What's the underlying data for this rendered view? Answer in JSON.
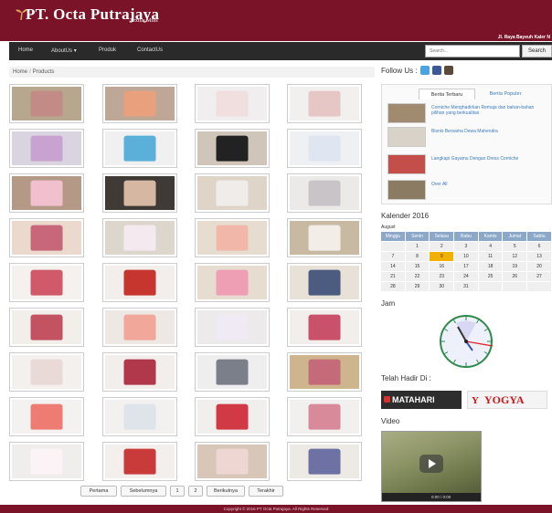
{
  "header": {
    "brand": "PT. Octa Putrajaya",
    "tagline": "Textile Mills",
    "address": "Jl. Raya Bayeuh Kaler N"
  },
  "nav": {
    "items": [
      "Home",
      "AboutUs",
      "Produk",
      "ContactUs"
    ],
    "search_placeholder": "Search...",
    "search_button": "Search"
  },
  "breadcrumb": [
    "Home",
    "Products"
  ],
  "products": [
    {
      "bg": "#b8a78f",
      "color": "#c28b86"
    },
    {
      "bg": "#bea796",
      "color": "#e8a07d"
    },
    {
      "bg": "#f0eeee",
      "color": "#f1dede"
    },
    {
      "bg": "#f2f0ee",
      "color": "#e7c7c6"
    },
    {
      "bg": "#d9d4e0",
      "color": "#c8a2d0"
    },
    {
      "bg": "#f0f0f0",
      "color": "#5ab0d8"
    },
    {
      "bg": "#cfc6b9",
      "color": "#222222"
    },
    {
      "bg": "#eef0f4",
      "color": "#dfe6f2"
    },
    {
      "bg": "#b49a86",
      "color": "#f1c0cf"
    },
    {
      "bg": "#3f3a36",
      "color": "#d6b7a2"
    },
    {
      "bg": "#ded5c8",
      "color": "#f0ecea"
    },
    {
      "bg": "#eceae8",
      "color": "#c8c4c8"
    },
    {
      "bg": "#ead9cc",
      "color": "#c8677a"
    },
    {
      "bg": "#ddd6cc",
      "color": "#f3e9ee"
    },
    {
      "bg": "#e6ddd0",
      "color": "#f1b8aa"
    },
    {
      "bg": "#c8b9a2",
      "color": "#f2ede7"
    },
    {
      "bg": "#f4f1ee",
      "color": "#d15a6a"
    },
    {
      "bg": "#f2eeec",
      "color": "#c7352f"
    },
    {
      "bg": "#e6dccf",
      "color": "#ee9fb4"
    },
    {
      "bg": "#e7e1d8",
      "color": "#4c5c80"
    },
    {
      "bg": "#f2eeea",
      "color": "#c45362"
    },
    {
      "bg": "#ede8e4",
      "color": "#f1a79a"
    },
    {
      "bg": "#eceaea",
      "color": "#efeaf4"
    },
    {
      "bg": "#f1eeec",
      "color": "#c9526a"
    },
    {
      "bg": "#f3f0ee",
      "color": "#e9dad8"
    },
    {
      "bg": "#f1eeec",
      "color": "#b0384a"
    },
    {
      "bg": "#efeeee",
      "color": "#7b7f8a"
    },
    {
      "bg": "#cfb58e",
      "color": "#c56a78"
    },
    {
      "bg": "#f4f2f0",
      "color": "#ef7c72"
    },
    {
      "bg": "#f3f1ef",
      "color": "#dfe3ea"
    },
    {
      "bg": "#f1efee",
      "color": "#d13a44"
    },
    {
      "bg": "#f2f0ef",
      "color": "#d88a9a"
    },
    {
      "bg": "#f0eeec",
      "color": "#fbf3f5"
    },
    {
      "bg": "#f2efec",
      "color": "#c93b3b"
    },
    {
      "bg": "#d8c6b8",
      "color": "#eed6d2"
    },
    {
      "bg": "#ede9e4",
      "color": "#6e71a3"
    }
  ],
  "pager": [
    "Pertama",
    "Sebelumnya",
    "1",
    "2",
    "Berikutnya",
    "Terakhir"
  ],
  "follow": {
    "label": "Follow Us :",
    "icons": [
      "twitter-icon",
      "facebook-icon",
      "instagram-icon"
    ],
    "colors": [
      "#4aa3df",
      "#3b5998",
      "#5b4a3a"
    ]
  },
  "tabs": {
    "active": "Berita Terbaru",
    "inactive": "Berita Populer"
  },
  "posts": [
    {
      "title": "Corniche Menghadirkan Remaja dan bahan-bahan pilihan yang berkualitas",
      "img": "#a08a70"
    },
    {
      "title": "Bisnis Bersama Dewa Mahendra",
      "img": "#d9d2c8"
    },
    {
      "title": "Langkapi Gayamu Dengan Dress Corniche",
      "img": "#c44f4a"
    },
    {
      "title": "Over All",
      "img": "#8c7b63"
    }
  ],
  "calendar": {
    "title": "Kalender 2016",
    "month": "August",
    "days": [
      "Minggu",
      "Senin",
      "Selasa",
      "Rabu",
      "Kamis",
      "Jumat",
      "Sabtu"
    ],
    "weeks": [
      [
        "",
        "1",
        "2",
        "3",
        "4",
        "5",
        "6"
      ],
      [
        "7",
        "8",
        "9",
        "10",
        "11",
        "12",
        "13"
      ],
      [
        "14",
        "15",
        "16",
        "17",
        "18",
        "19",
        "20"
      ],
      [
        "21",
        "22",
        "23",
        "24",
        "25",
        "26",
        "27"
      ],
      [
        "28",
        "29",
        "30",
        "31",
        "",
        "",
        ""
      ]
    ],
    "today": "9"
  },
  "clock_title": "Jam",
  "partners": {
    "title": "Telah Hadir Di :",
    "names": [
      "MATAHARI",
      "YOGYA"
    ]
  },
  "video": {
    "title": "Video",
    "time": "0:00 / 0:00"
  },
  "footer": "Copyright © 2016 PT Octa Putrajaya. All Rights Reserved"
}
